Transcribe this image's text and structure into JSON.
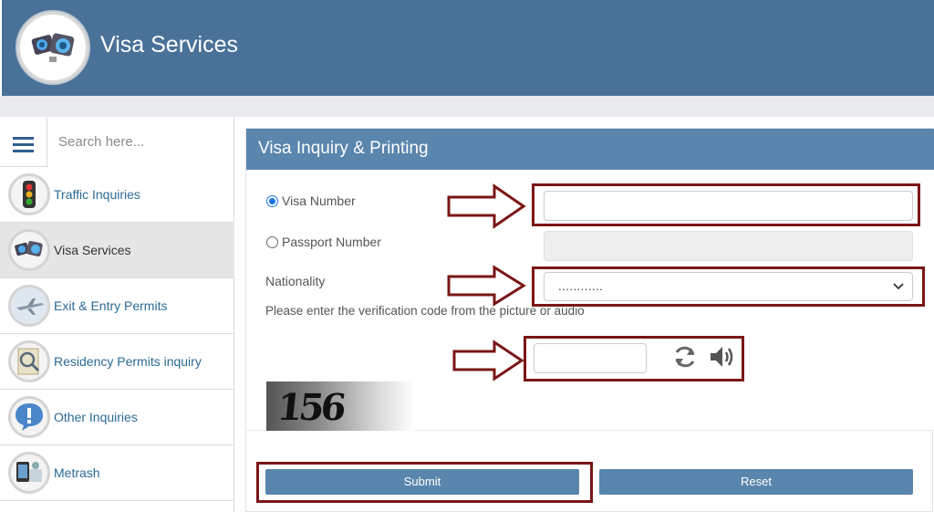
{
  "header": {
    "title": "Visa Services"
  },
  "sidebar": {
    "search_placeholder": "Search here...",
    "items": [
      {
        "label": "Traffic Inquiries",
        "icon": "traffic-light-icon"
      },
      {
        "label": "Visa Services",
        "icon": "visa-services-icon",
        "active": true
      },
      {
        "label": "Exit & Entry Permits",
        "icon": "airplane-icon"
      },
      {
        "label": "Residency Permits inquiry",
        "icon": "residency-search-icon"
      },
      {
        "label": "Other Inquiries",
        "icon": "exclamation-icon"
      },
      {
        "label": "Metrash",
        "icon": "metrash-icon"
      }
    ]
  },
  "form": {
    "title": "Visa Inquiry & Printing",
    "visa_number_label": "Visa Number",
    "visa_number_value": "",
    "passport_number_label": "Passport Number",
    "passport_number_value": "",
    "selected_option": "Visa Number",
    "nationality_label": "Nationality",
    "nationality_value": "............",
    "verification_prompt": "Please enter the verification code from the picture or audio",
    "captcha_text": "156",
    "captcha_value": "",
    "submit_label": "Submit",
    "reset_label": "Reset"
  },
  "colors": {
    "header_bg": "#4a7299",
    "panel_header_bg": "#5a85ad",
    "button_bg": "#5a85ad",
    "highlight_box": "#7a1616",
    "link_text": "#2b6a95"
  }
}
